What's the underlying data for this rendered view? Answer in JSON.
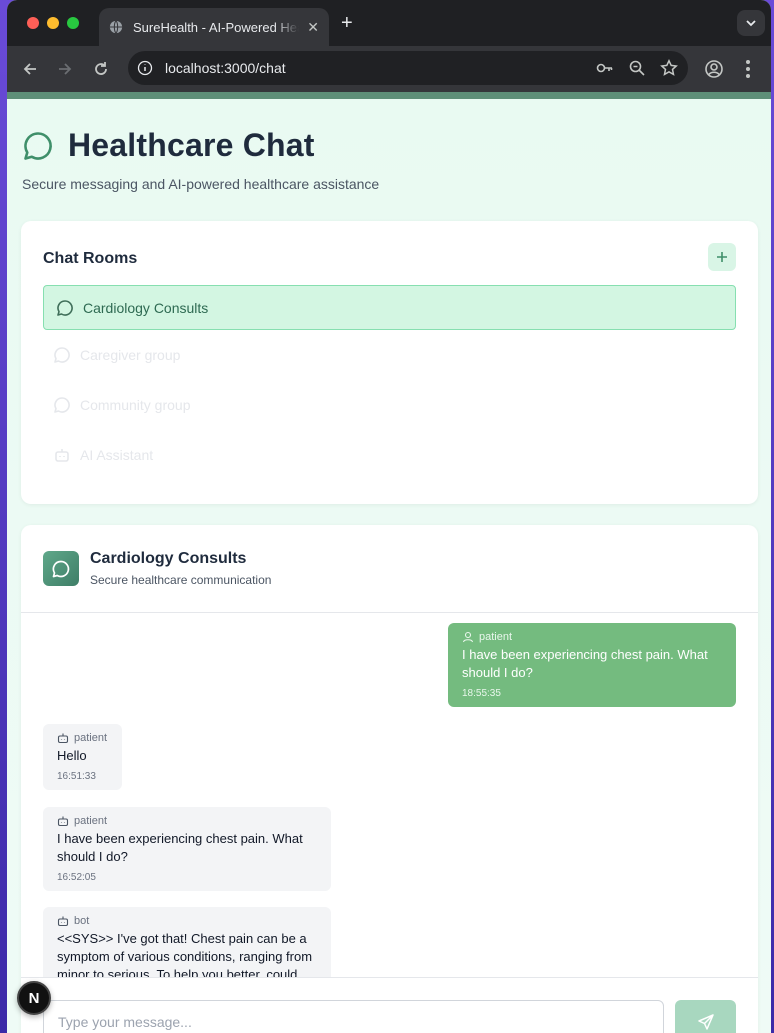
{
  "browser": {
    "tab_title": "SureHealth - AI-Powered Healthcare",
    "tab_close": "✕",
    "new_tab": "+",
    "url": "localhost:3000/chat"
  },
  "page": {
    "title": "Healthcare Chat",
    "subtitle": "Secure messaging and AI-powered healthcare assistance"
  },
  "rooms": {
    "heading": "Chat Rooms",
    "add_label": "+",
    "items": [
      {
        "label": "Cardiology Consults",
        "icon": "message-icon",
        "active": true
      },
      {
        "label": "Caregiver group",
        "icon": "message-icon",
        "active": false
      },
      {
        "label": "Community group",
        "icon": "message-icon",
        "active": false
      },
      {
        "label": "AI Assistant",
        "icon": "bot-icon",
        "active": false
      }
    ]
  },
  "chat": {
    "name": "Cardiology Consults",
    "description": "Secure healthcare communication",
    "messages": [
      {
        "sender": "patient",
        "icon": "user-icon",
        "text": "I have been experiencing chest pain. What should I do?",
        "time": "18:55:35",
        "outgoing": true
      },
      {
        "sender": "patient",
        "icon": "bot-icon",
        "text": "Hello",
        "time": "16:51:33",
        "outgoing": false
      },
      {
        "sender": "patient",
        "icon": "bot-icon",
        "text": "I have been experiencing chest pain. What should I do?",
        "time": "16:52:05",
        "outgoing": false
      },
      {
        "sender": "bot",
        "icon": "bot-icon",
        "text": "<<SYS>> I've got that! Chest pain can be a symptom of various conditions, ranging from minor to serious. To help you better, could you",
        "time": "",
        "outgoing": false
      }
    ],
    "input_placeholder": "Type your message..."
  },
  "dev_badge": "N",
  "colors": {
    "accent": "#74bb7f",
    "active_room_bg": "#d3f6e2",
    "active_room_border": "#86dfb0",
    "title_text": "#1f2b3d"
  }
}
